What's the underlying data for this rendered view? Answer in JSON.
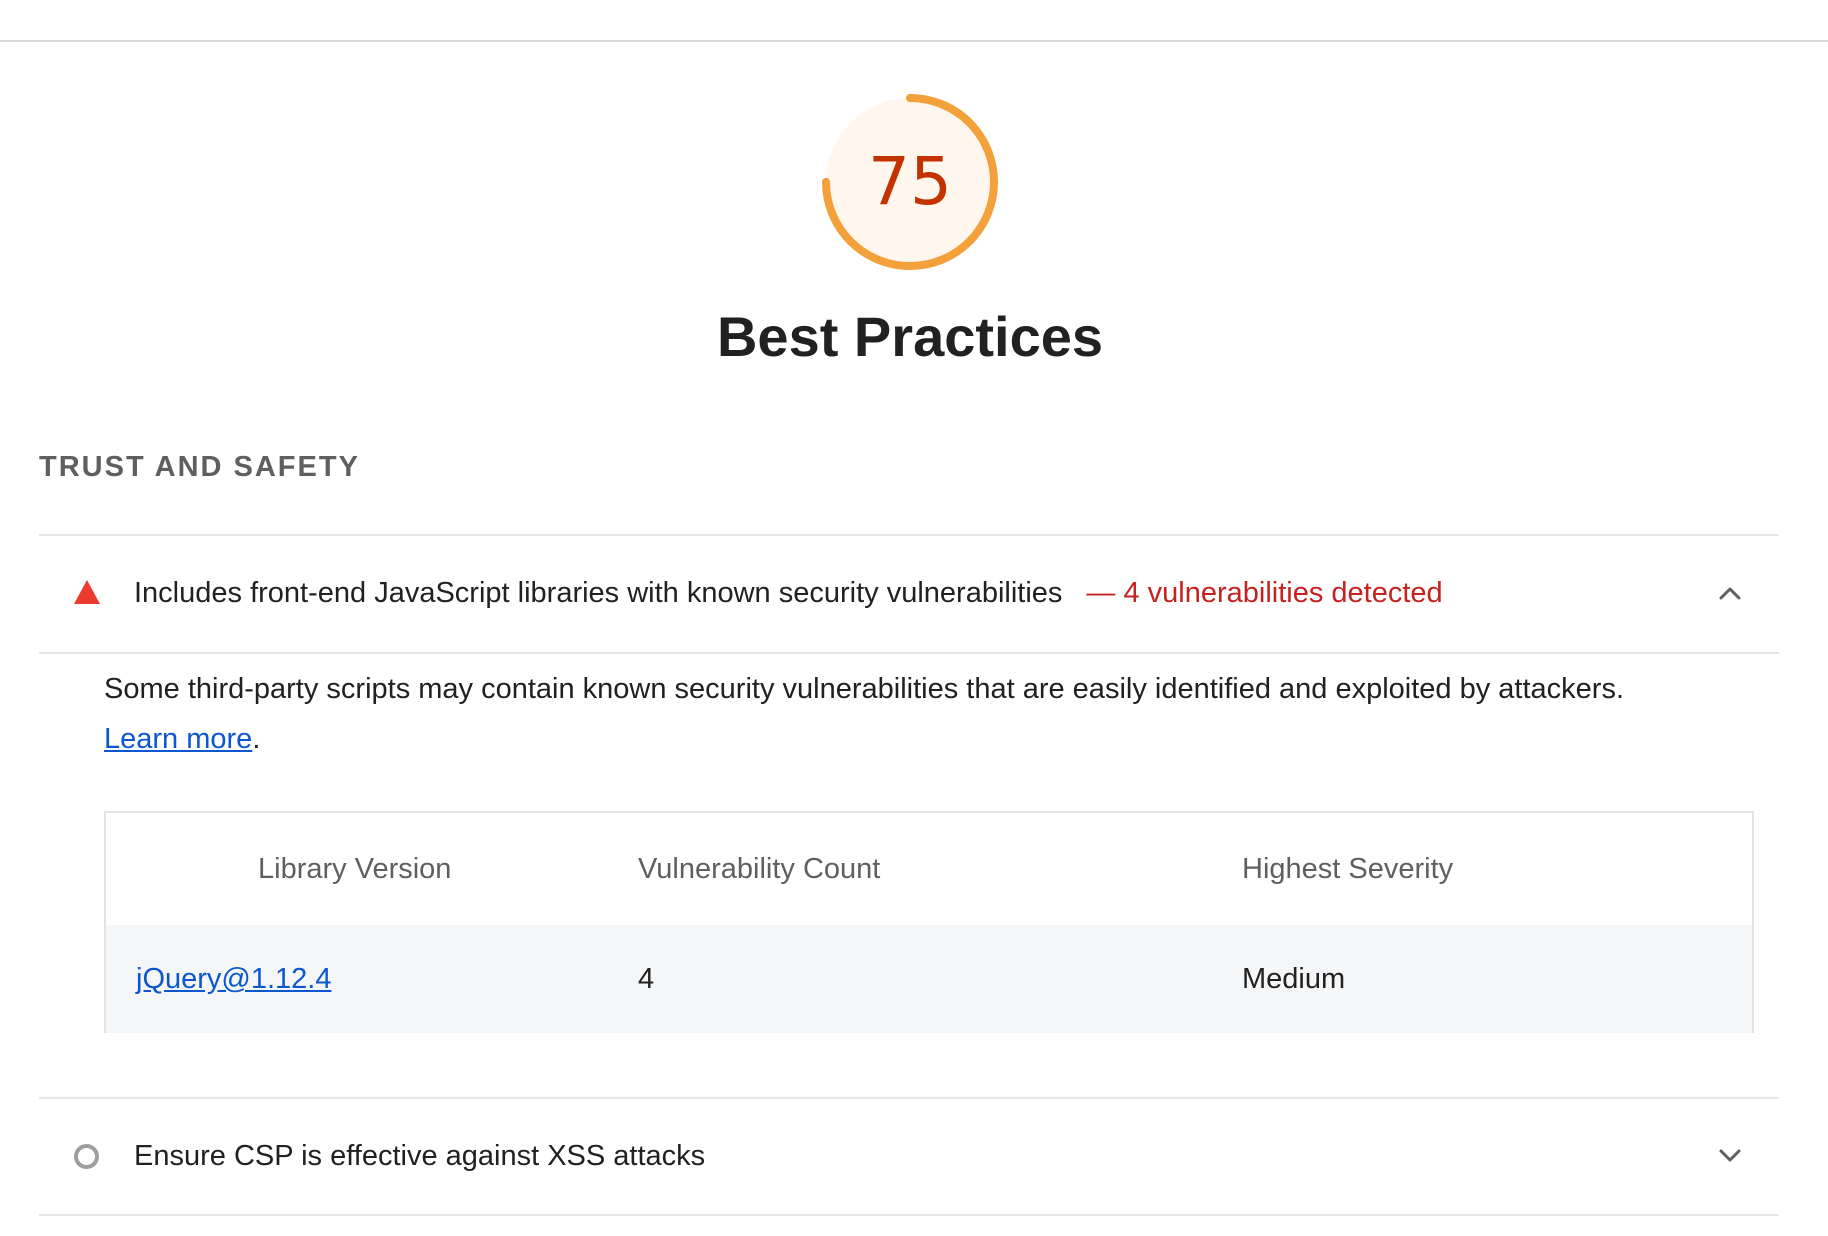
{
  "score": {
    "value": "75",
    "fraction": 0.75,
    "color": "#f4a03b",
    "text_color": "#c33300",
    "fill_color": "#fff6ee"
  },
  "category": {
    "title": "Best Practices"
  },
  "group": {
    "title": "TRUST AND SAFETY"
  },
  "audits": [
    {
      "status": "fail",
      "icon": "warning-triangle-icon",
      "title": "Includes front-end JavaScript libraries with known security vulnerabilities",
      "display_value": "— 4 vulnerabilities detected",
      "expanded": true,
      "description": "Some third-party scripts may contain known security vulnerabilities that are easily identified and exploited by attackers.",
      "learn_more": "Learn more",
      "learn_more_suffix": ".",
      "table": {
        "headers": [
          "Library Version",
          "Vulnerability Count",
          "Highest Severity"
        ],
        "rows": [
          {
            "library": "jQuery@1.12.4",
            "count": "4",
            "severity": "Medium"
          }
        ]
      }
    },
    {
      "status": "not-applicable",
      "icon": "circle-outline-icon",
      "title": "Ensure CSP is effective against XSS attacks",
      "expanded": false
    }
  ],
  "colors": {
    "fail": "#eb3b2f",
    "display_value": "#c5221f",
    "link": "#0b57d0",
    "neutral": "#9e9e9e"
  }
}
